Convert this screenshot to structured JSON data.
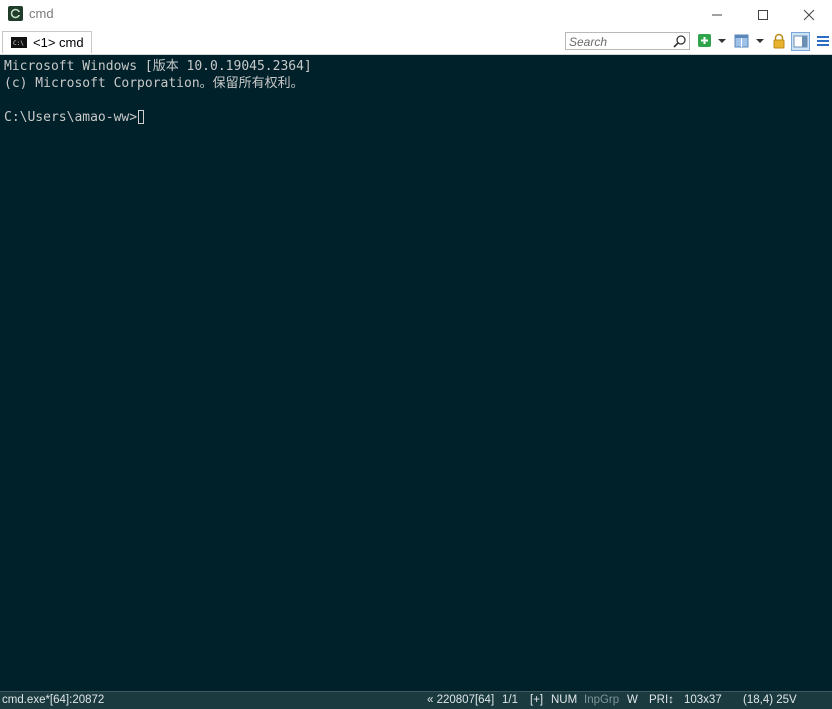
{
  "window": {
    "title": "cmd",
    "minimize_glyph": "—",
    "maximize_glyph": "☐",
    "close_glyph": "✕"
  },
  "tabs": [
    {
      "label": "<1> cmd",
      "icon": "console-icon"
    }
  ],
  "search": {
    "placeholder": "Search",
    "value": ""
  },
  "toolbar": {
    "icons": [
      "search-icon",
      "new-console-icon",
      "dropdown-icon",
      "split-view-icon",
      "dropdown-icon",
      "lock-icon",
      "panel-view-icon",
      "menu-icon"
    ],
    "accent_green": "#2fa44a"
  },
  "console": {
    "background": "#00212a",
    "foreground": "#c8c8c8",
    "lines": [
      "Microsoft Windows [版本 10.0.19045.2364]",
      "(c) Microsoft Corporation。保留所有权利。",
      "",
      "C:\\Users\\amao-ww>"
    ]
  },
  "statusbar": {
    "process": "cmd.exe*[64]:20872",
    "server": "« 220807[64]",
    "pane": "1/1",
    "plus": "[+]",
    "num": "NUM",
    "inpgrp": "InpGrp",
    "w": "W",
    "pri": "PRI↕",
    "size": "103x37",
    "coords": "(18,4) 25V"
  }
}
